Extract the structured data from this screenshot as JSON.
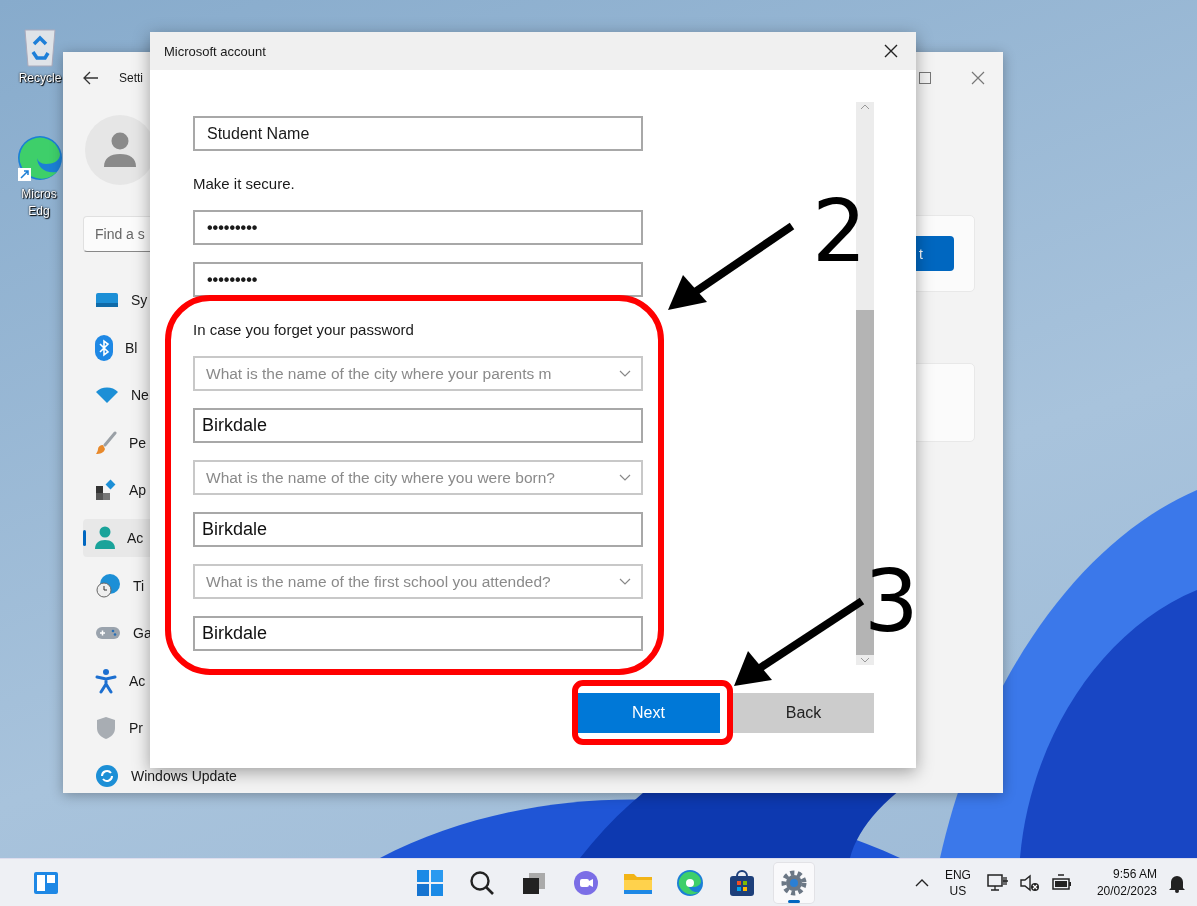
{
  "desktop_icons": [
    {
      "kind": "recycle_bin",
      "label": "Recycle"
    },
    {
      "kind": "edge",
      "label": "Micros Edg"
    }
  ],
  "settings_window": {
    "title": "Setti",
    "search_placeholder": "Find a s",
    "card_button": "t",
    "nav": [
      {
        "kind": "system",
        "label": "Sy",
        "selected": false
      },
      {
        "kind": "bluetooth",
        "label": "Bl",
        "selected": false
      },
      {
        "kind": "network",
        "label": "Ne",
        "selected": false
      },
      {
        "kind": "personalization",
        "label": "Pe",
        "selected": false
      },
      {
        "kind": "apps",
        "label": "Ap",
        "selected": false
      },
      {
        "kind": "accounts",
        "label": "Ac",
        "selected": true
      },
      {
        "kind": "time",
        "label": "Ti",
        "selected": false
      },
      {
        "kind": "gaming",
        "label": "Ga",
        "selected": false
      },
      {
        "kind": "accessibility",
        "label": "Ac",
        "selected": false
      },
      {
        "kind": "privacy",
        "label": "Pr",
        "selected": false
      },
      {
        "kind": "update",
        "label": "Windows Update",
        "selected": false
      }
    ]
  },
  "dialog": {
    "title": "Microsoft account",
    "fields": [
      {
        "kind": "text",
        "value": "Student Name"
      },
      {
        "kind": "label",
        "text": "Make it secure."
      },
      {
        "kind": "password",
        "value": "•••••••••"
      },
      {
        "kind": "password",
        "value": "•••••••••"
      },
      {
        "kind": "label",
        "text": "In case you forget your password"
      },
      {
        "kind": "dropdown",
        "value": "What is the name of the city where your parents m"
      },
      {
        "kind": "answer",
        "value": "Birkdale"
      },
      {
        "kind": "dropdown",
        "value": "What is the name of the city where you were born?"
      },
      {
        "kind": "answer",
        "value": "Birkdale"
      },
      {
        "kind": "dropdown",
        "value": "What is the name of the first school you attended?"
      },
      {
        "kind": "answer",
        "value": "Birkdale"
      }
    ],
    "buttons": [
      {
        "label": "Next",
        "primary": true
      },
      {
        "label": "Back",
        "primary": false
      }
    ]
  },
  "annotations": [
    {
      "label": "2"
    },
    {
      "label": "3"
    }
  ],
  "taskbar": {
    "left": [
      {
        "kind": "widgets",
        "active": false
      }
    ],
    "pinned": [
      {
        "kind": "start",
        "active": false
      },
      {
        "kind": "search",
        "active": false
      },
      {
        "kind": "taskview",
        "active": false
      },
      {
        "kind": "chat",
        "active": false
      },
      {
        "kind": "explorer",
        "active": false
      },
      {
        "kind": "edge",
        "active": false
      },
      {
        "kind": "store",
        "active": false
      },
      {
        "kind": "settings",
        "active": true
      }
    ],
    "language": "ENG",
    "region": "US",
    "tray": [
      {
        "kind": "network"
      },
      {
        "kind": "volume_muted"
      },
      {
        "kind": "battery"
      }
    ],
    "time": "9:56 AM",
    "date": "20/02/2023"
  }
}
